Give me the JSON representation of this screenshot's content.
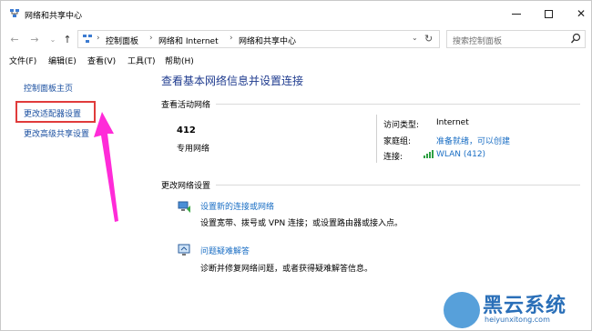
{
  "window": {
    "title": "网络和共享中心",
    "minimize_icon": "minimize-icon",
    "maximize_icon": "maximize-icon",
    "close_icon": "close-icon",
    "close_glyph": "✕"
  },
  "nav": {
    "back_glyph": "←",
    "forward_glyph": "→",
    "recent_glyph": "⌄",
    "up_glyph": "↑",
    "breadcrumb": [
      "控制面板",
      "网络和 Internet",
      "网络和共享中心"
    ],
    "separator": "›",
    "dropdown_glyph": "⌄",
    "refresh_glyph": "↻",
    "search_placeholder": "搜索控制面板"
  },
  "menu": [
    "文件(F)",
    "编辑(E)",
    "查看(V)",
    "工具(T)",
    "帮助(H)"
  ],
  "sidebar": {
    "items": [
      "控制面板主页",
      "更改适配器设置",
      "更改高级共享设置"
    ],
    "highlighted_index": 1,
    "highlight_color": "#e03b3b",
    "arrow_color": "#ff2bd8"
  },
  "main": {
    "heading": "查看基本网络信息并设置连接",
    "active_section_title": "查看活动网络",
    "network_name": "412",
    "network_category": "专用网络",
    "properties": [
      {
        "label": "访问类型:",
        "value": "Internet"
      },
      {
        "label": "家庭组:",
        "value": "准备就绪，可以创建"
      },
      {
        "label": "连接:",
        "value": "WLAN (412)"
      }
    ],
    "change_section_title": "更改网络设置",
    "tasks": [
      {
        "icon": "new-connection-icon",
        "link": "设置新的连接或网络",
        "desc": "设置宽带、拨号或 VPN 连接；或设置路由器或接入点。"
      },
      {
        "icon": "troubleshoot-icon",
        "link": "问题疑难解答",
        "desc": "诊断并修复网络问题，或者获得疑难解答信息。"
      }
    ]
  },
  "watermark": {
    "title": "黑云系统",
    "url": "heiyunxitong.com"
  }
}
